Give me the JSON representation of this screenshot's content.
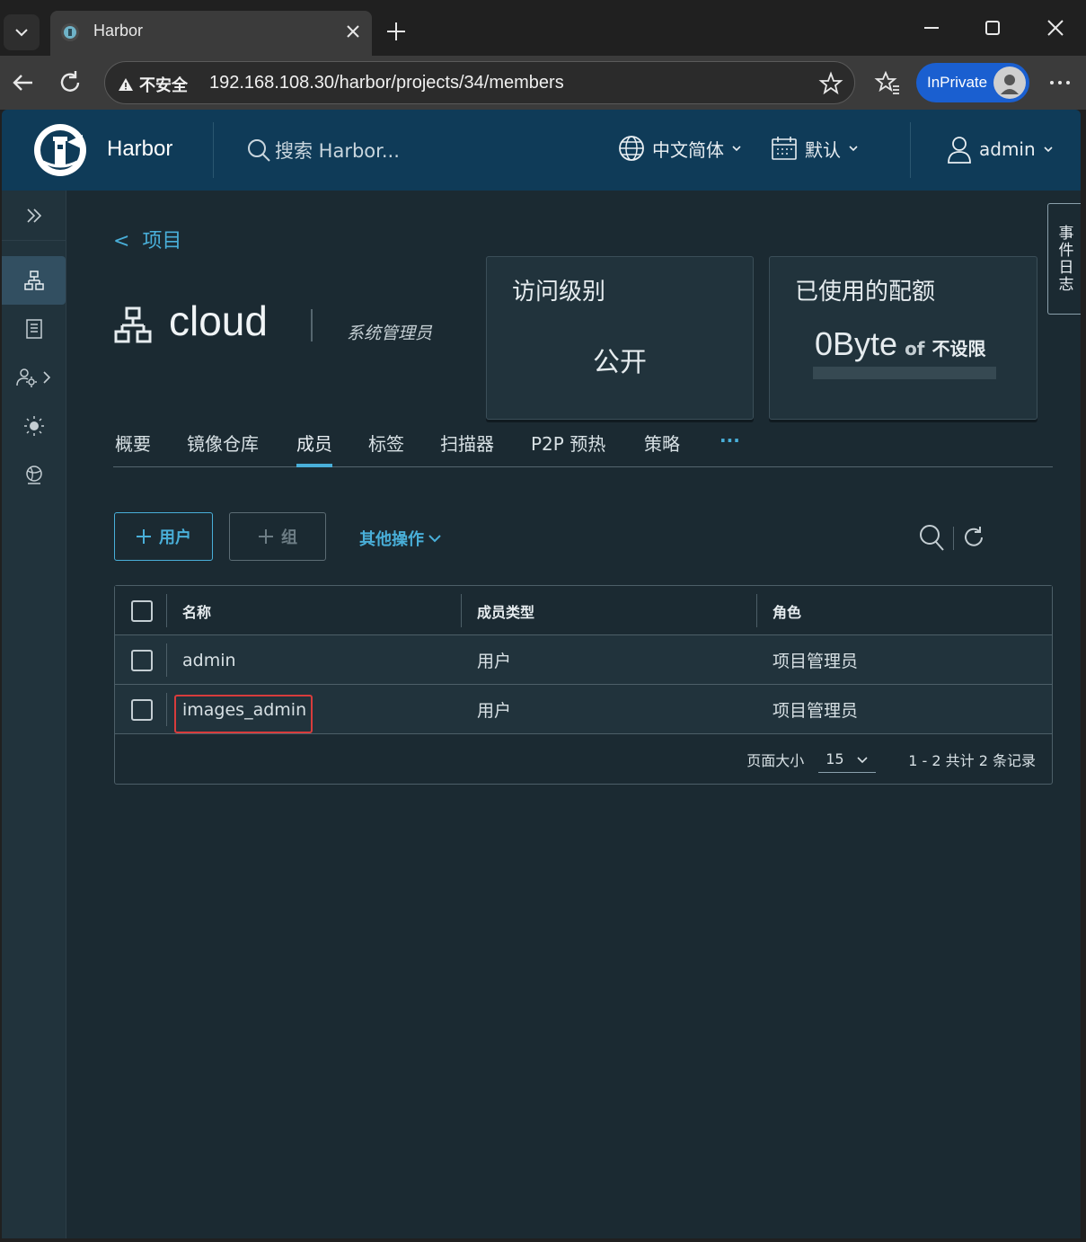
{
  "browser": {
    "tab_title": "Harbor",
    "security_label": "不安全",
    "url": "192.168.108.30/harbor/projects/34/members",
    "inprivate_label": "InPrivate"
  },
  "header": {
    "brand": "Harbor",
    "search_placeholder": "搜索 Harbor...",
    "language": "中文简体",
    "theme": "默认",
    "user": "admin"
  },
  "event_log": "事件日志",
  "breadcrumb": {
    "back": "<  项目"
  },
  "project": {
    "name": "cloud",
    "role": "系统管理员"
  },
  "cards": {
    "access": {
      "title": "访问级别",
      "value": "公开"
    },
    "quota": {
      "title": "已使用的配额",
      "value": "0Byte",
      "of": "of",
      "limit": "不设限"
    }
  },
  "tabs": [
    "概要",
    "镜像仓库",
    "成员",
    "标签",
    "扫描器",
    "P2P 预热",
    "策略",
    "···"
  ],
  "actions": {
    "add_user": "用户",
    "add_group": "组",
    "more": "其他操作"
  },
  "table": {
    "columns": [
      "名称",
      "成员类型",
      "角色"
    ],
    "rows": [
      {
        "name": "admin",
        "type": "用户",
        "role": "项目管理员"
      },
      {
        "name": "images_admin",
        "type": "用户",
        "role": "项目管理员"
      }
    ],
    "page_size_label": "页面大小",
    "page_size": "15",
    "summary": "1 - 2 共计 2 条记录"
  },
  "colors": {
    "accent": "#49afd9",
    "header_bg": "#0f3b58",
    "app_bg": "#1b2a32",
    "highlight": "#d83c3c"
  }
}
